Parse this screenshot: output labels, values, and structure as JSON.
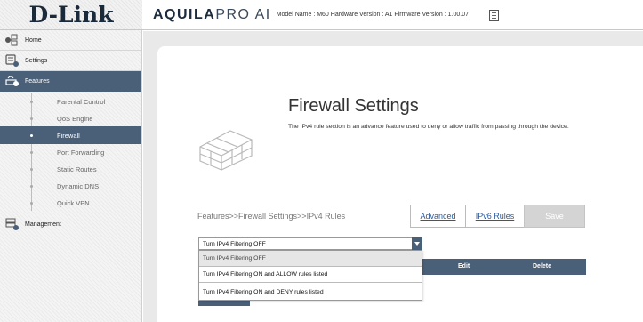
{
  "header": {
    "logo": "D-Link",
    "brand_main": "AQUILA",
    "brand_pro": "PRO AI",
    "model_info": "Model Name : M60 Hardware Version : A1 Firmware Version : 1.00.07",
    "icon": "document-icon"
  },
  "sidebar": {
    "items": [
      {
        "label": "Home",
        "icon": "home-network-icon"
      },
      {
        "label": "Settings",
        "icon": "settings-icon"
      },
      {
        "label": "Features",
        "icon": "features-icon"
      },
      {
        "label": "Management",
        "icon": "management-icon"
      }
    ],
    "sub_items": [
      {
        "label": "Parental Control"
      },
      {
        "label": "QoS Engine"
      },
      {
        "label": "Firewall"
      },
      {
        "label": "Port Forwarding"
      },
      {
        "label": "Static Routes"
      },
      {
        "label": "Dynamic DNS"
      },
      {
        "label": "Quick VPN"
      }
    ]
  },
  "page": {
    "title": "Firewall Settings",
    "description": "The IPv4 rule section is an advance feature used to deny or allow traffic from passing through the device.",
    "breadcrumb": "Features>>Firewall Settings>>IPv4 Rules",
    "tabs": {
      "advanced": "Advanced",
      "ipv6": "IPv6 Rules",
      "save": "Save"
    },
    "filter_select": {
      "value": "Turn IPv4 Filtering OFF",
      "options": [
        "Turn IPv4 Filtering OFF",
        "Turn IPv4 Filtering ON and ALLOW rules listed",
        "Turn IPv4 Filtering ON and DENY rules listed"
      ]
    },
    "table": {
      "edit": "Edit",
      "delete": "Delete"
    }
  },
  "colors": {
    "accent": "#4a5f78",
    "save_disabled": "#d4d4d4",
    "link": "#2a5a9a"
  }
}
